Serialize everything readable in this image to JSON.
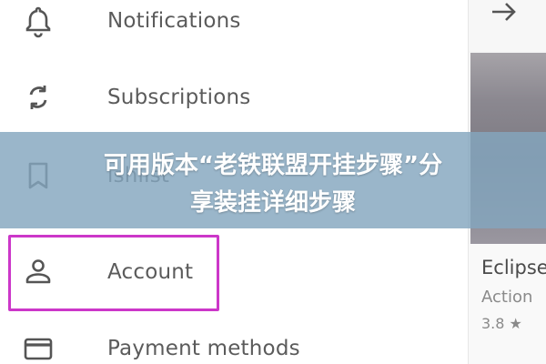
{
  "drawer": {
    "items": [
      {
        "id": "notifications",
        "label": "Notifications",
        "icon": "bell-icon"
      },
      {
        "id": "subscriptions",
        "label": "Subscriptions",
        "icon": "sync-icon"
      },
      {
        "id": "watchlist",
        "label": "ishlist",
        "icon": "bookmark-icon"
      },
      {
        "id": "account",
        "label": "Account",
        "icon": "person-icon",
        "highlighted": true
      },
      {
        "id": "payment",
        "label": "Payment methods",
        "icon": "credit-card-icon"
      }
    ]
  },
  "highlight": {
    "color": "#cc37c9"
  },
  "right_panel": {
    "back_icon": "arrow-right-icon",
    "card": {
      "title": "Eclipse",
      "genre": "Action",
      "rating": "3.8 ★"
    }
  },
  "overlay": {
    "line1": "可用版本“老铁联盟开挂步骤”分",
    "line2": "享装挂详细步骤",
    "background": "#84a6be"
  }
}
